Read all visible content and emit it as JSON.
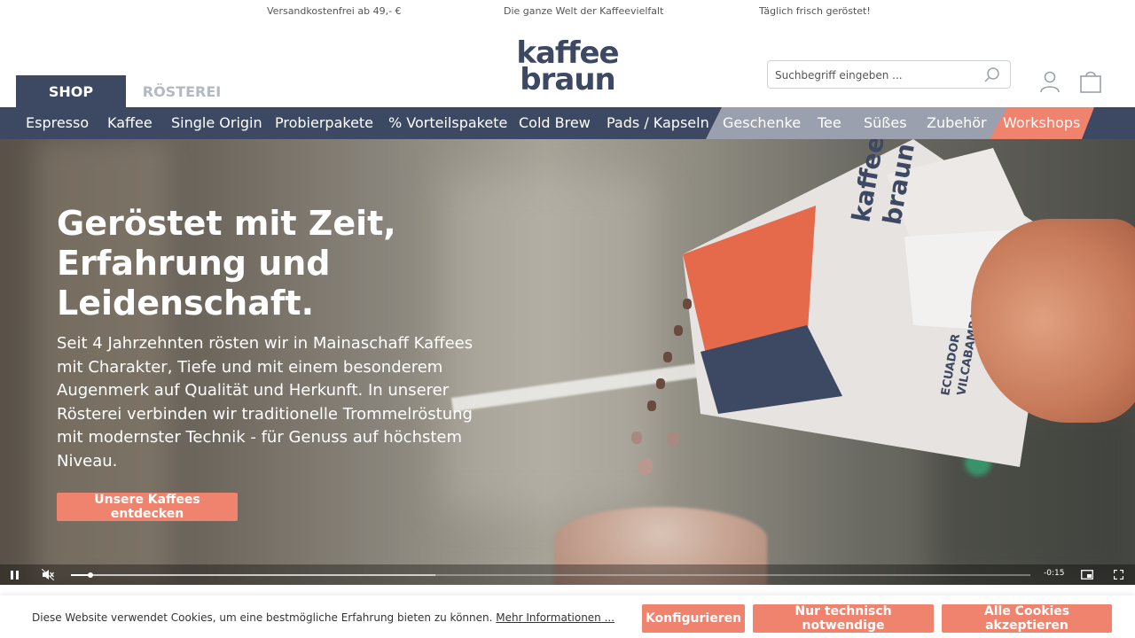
{
  "usp": {
    "shipping": "Versandkostenfrei ab 49,- €",
    "variety": "Die ganze Welt der Kaffeevielfalt",
    "fresh": "Täglich frisch geröstet!"
  },
  "header": {
    "tabs": [
      {
        "label": "SHOP",
        "active": true
      },
      {
        "label": "RÖSTEREI",
        "active": false
      }
    ],
    "logo": {
      "line1": "kaffee",
      "line2": "braun"
    },
    "search": {
      "placeholder": "Suchbegriff eingeben ..."
    },
    "icons": [
      "search-icon",
      "account-icon",
      "cart-icon"
    ]
  },
  "nav": {
    "items": [
      "Espresso",
      "Kaffee",
      "Single Origin",
      "Probierpakete",
      "% Vorteilspakete",
      "Cold Brew",
      "Pads / Kapseln",
      "Geschenke",
      "Tee",
      "Süßes",
      "Zubehör",
      "Workshops"
    ]
  },
  "hero": {
    "title": "Geröstet mit Zeit, Erfahrung und Leidenschaft.",
    "text": "Seit 4 Jahrzehnten rösten wir in Mainaschaff Kaffees mit Charakter, Tiefe und mit einem besonderem Augenmerk auf Qualität und Herkunft. In unserer Rösterei verbinden wir traditionelle Trommelröstung mit modernster Technik - für Genuss auf höchstem Niveau.",
    "cta": "Unsere Kaffees entdecken",
    "bag_label": {
      "line1": "ECUADOR",
      "line2": "VILCABAMBA"
    }
  },
  "video": {
    "time_remaining": "-0:15",
    "progress_fraction": 0.02,
    "buffered_fraction": 0.38,
    "muted": true,
    "playing": true
  },
  "cookie": {
    "text": "Diese Website verwendet Cookies, um eine bestmögliche Erfahrung bieten zu können.",
    "more_link": "Mehr Informationen ...",
    "buttons": {
      "configure": "Konfigurieren",
      "technical": "Nur technisch notwendige",
      "accept_all": "Alle Cookies akzeptieren"
    }
  },
  "colors": {
    "navy": "#3d4862",
    "salmon": "#f0836e",
    "grey_nav": "#9aa0ad",
    "tab_inactive": "#b4b8c2"
  }
}
